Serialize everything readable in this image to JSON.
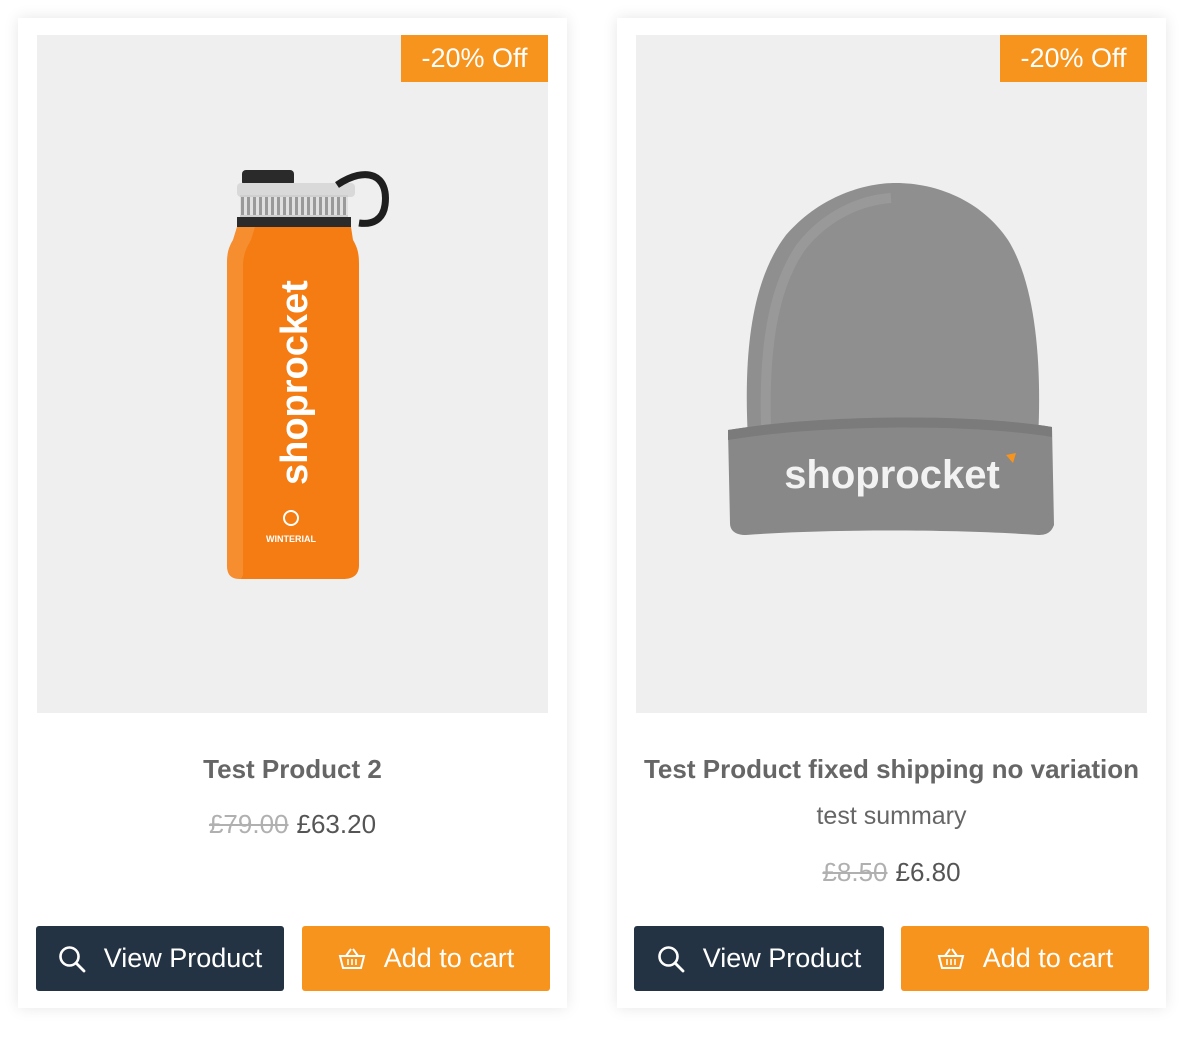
{
  "colors": {
    "accent": "#f7941d",
    "dark_button": "#233343",
    "image_bg": "#efefef",
    "title_text": "#666666",
    "old_price": "#b0b0b0"
  },
  "products": [
    {
      "badge": "-20% Off",
      "image_icon": "orange-water-bottle",
      "image_text": "shoprocket",
      "image_subtext": "WINTERIAL",
      "title": "Test Product 2",
      "summary": "",
      "old_price": "£79.00",
      "new_price": "£63.20",
      "view_label": "View Product",
      "cart_label": "Add to cart"
    },
    {
      "badge": "-20% Off",
      "image_icon": "grey-beanie",
      "image_text": "shoprocket",
      "title": "Test Product fixed shipping no variation",
      "summary": "test summary",
      "old_price": "£8.50",
      "new_price": "£6.80",
      "view_label": "View Product",
      "cart_label": "Add to cart"
    }
  ]
}
